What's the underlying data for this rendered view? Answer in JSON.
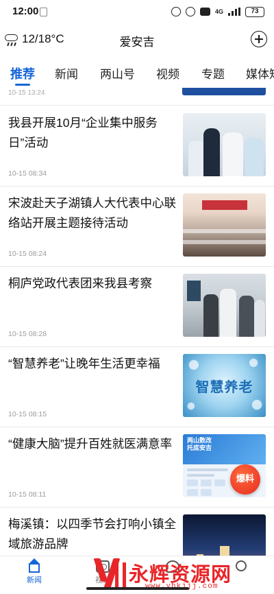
{
  "status_bar": {
    "time": "12:00",
    "network": "4G",
    "battery": "73"
  },
  "header": {
    "weather": "12/18°C",
    "weather_icon": "rain-cloud-icon",
    "title": "爱安吉",
    "add_icon": "plus-circle-icon"
  },
  "tabs": [
    {
      "label": "推荐",
      "active": true
    },
    {
      "label": "新闻",
      "active": false
    },
    {
      "label": "两山号",
      "active": false
    },
    {
      "label": "视频",
      "active": false
    },
    {
      "label": "专题",
      "active": false
    },
    {
      "label": "媒体矩阵",
      "active": false
    }
  ],
  "feed": {
    "partial_item": {
      "date": "10-15 13:24"
    },
    "items": [
      {
        "title": "我县开展10月“企业集中服务日”活动",
        "date": "10-15 08:34"
      },
      {
        "title": "宋波赴天子湖镇人大代表中心联络站开展主题接待活动",
        "date": "10-15 08:24"
      },
      {
        "title": "桐庐党政代表团来我县考察",
        "date": "10-15 08:28"
      },
      {
        "title": "“智慧养老”让晚年生活更幸福",
        "date": "10-15 08:15",
        "thumb_text": "智慧养老"
      },
      {
        "title": "“健康大脑”提升百姓就医满意率",
        "date": "10-15 08:11",
        "thumb_text": "两山数改\n托底安吉"
      },
      {
        "title": "梅溪镇：以四季节会打响小镇全域旅游品牌",
        "date": ""
      }
    ]
  },
  "report_button": {
    "label": "爆料"
  },
  "bottom_nav": [
    {
      "label": "新闻",
      "icon": "home-icon",
      "active": true
    },
    {
      "label": "视频",
      "icon": "camera-icon",
      "active": false
    },
    {
      "label": "",
      "icon": "people-icon",
      "active": false
    },
    {
      "label": "",
      "icon": "user-icon",
      "active": false
    }
  ],
  "watermark": {
    "text": "永辉资源网",
    "url": "www.yhkjjj.com"
  },
  "colors": {
    "accent": "#1565d8",
    "watermark": "#e8262a"
  }
}
